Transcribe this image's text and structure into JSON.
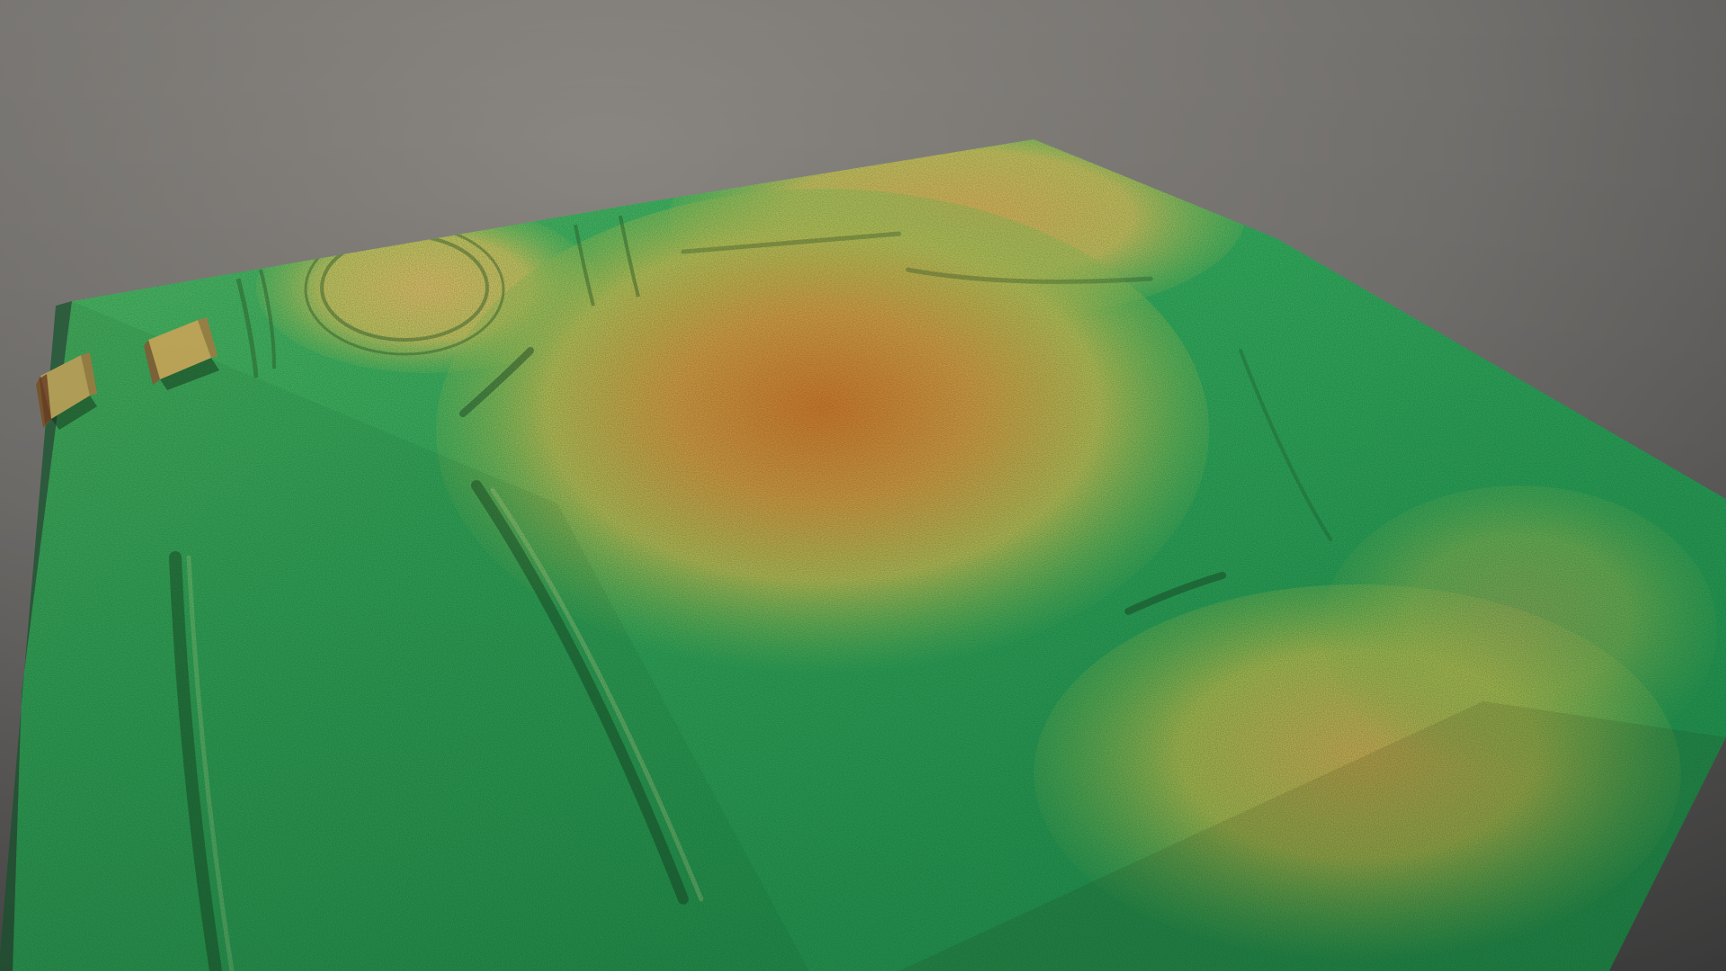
{
  "scene": {
    "subject": "",
    "colors": {
      "background_top": "#5f5f5f",
      "background_center": "#8a8681",
      "low_terrain": "#2fa660",
      "mid_terrain": "#9ec85e",
      "high_terrain": "#d9b15f",
      "peak_terrain": "#d27a34",
      "building": "#c8a55a",
      "shadow": "#1b3b20"
    }
  }
}
